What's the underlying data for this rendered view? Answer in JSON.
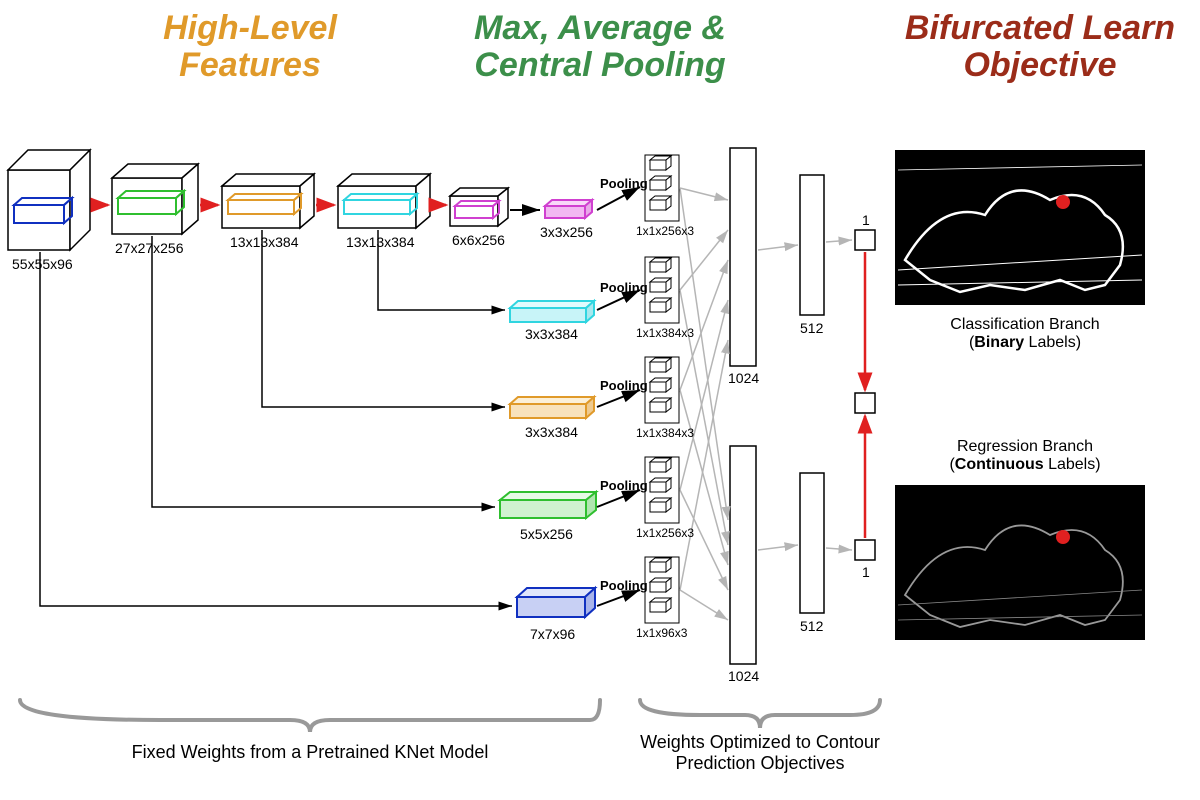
{
  "headers": {
    "left": "High-Level\nFeatures",
    "mid": "Max, Average &\nCentral Pooling",
    "right": "Bifurcated Learn\nObjective"
  },
  "colors": {
    "left": "#e09a2a",
    "mid": "#3c8f4a",
    "right": "#9b2c19"
  },
  "conv": {
    "l1": "55x55x96",
    "l2": "27x27x256",
    "l3": "13x13x384",
    "l4": "13x13x384",
    "l5": "6x6x256",
    "crop5": "3x3x256",
    "crop4": "3x3x384",
    "crop3": "3x3x384",
    "crop2": "5x5x256",
    "crop1": "7x7x96"
  },
  "pool_word": "Pooling",
  "pool_out": {
    "p5": "1x1x256x3",
    "p4": "1x1x384x3",
    "p3": "1x1x384x3",
    "p2": "1x1x256x3",
    "p1": "1x1x96x3"
  },
  "fc": {
    "a": "1024",
    "b": "512",
    "c": "1"
  },
  "branches": {
    "cls": "Classification Branch\n(**Binary** Labels)",
    "reg": "Regression Branch\n(**Continuous** Labels)"
  },
  "footer": {
    "left": "Fixed Weights from a Pretrained KNet Model",
    "right": "Weights Optimized to Contour\nPrediction Objectives"
  }
}
